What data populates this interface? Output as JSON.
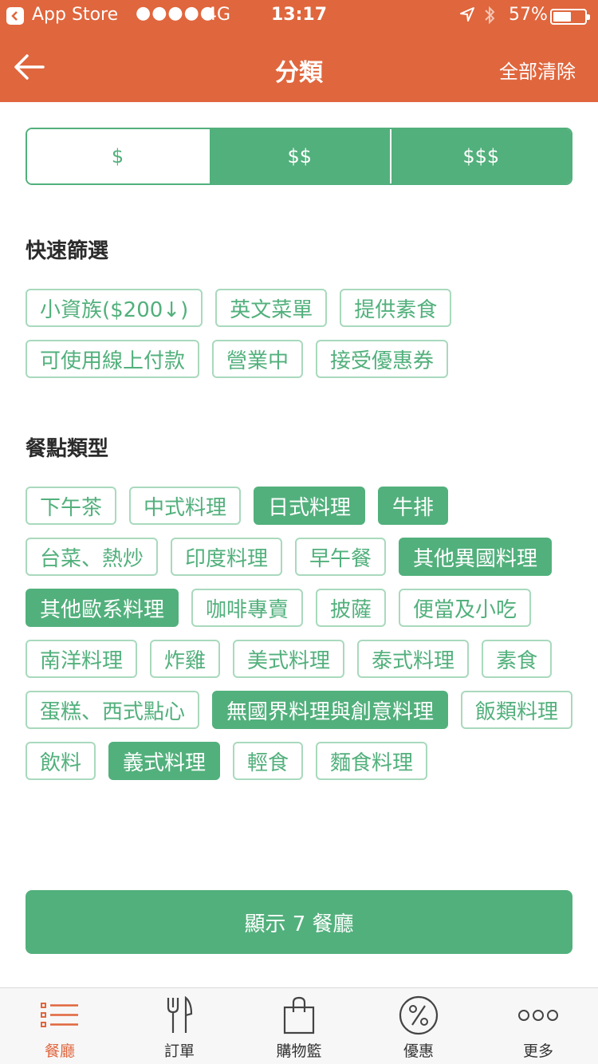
{
  "status_bar": {
    "carrier": "App Store",
    "signal": "●●●●●",
    "network": "4G",
    "time": "13:17",
    "battery": "57%",
    "battery_level": 0.57
  },
  "nav": {
    "title": "分類",
    "clear_all": "全部清除"
  },
  "price_levels": [
    {
      "label": "$",
      "selected": false
    },
    {
      "label": "$$",
      "selected": true
    },
    {
      "label": "$$$",
      "selected": true
    }
  ],
  "quick_filter": {
    "title": "快速篩選",
    "items": [
      {
        "label": "小資族($200↓)",
        "selected": false
      },
      {
        "label": "英文菜單",
        "selected": false
      },
      {
        "label": "提供素食",
        "selected": false
      },
      {
        "label": "可使用線上付款",
        "selected": false
      },
      {
        "label": "營業中",
        "selected": false
      },
      {
        "label": "接受優惠券",
        "selected": false
      }
    ]
  },
  "meal_types": {
    "title": "餐點類型",
    "items": [
      {
        "label": "下午茶",
        "selected": false
      },
      {
        "label": "中式料理",
        "selected": false
      },
      {
        "label": "日式料理",
        "selected": true
      },
      {
        "label": "牛排",
        "selected": true
      },
      {
        "label": "台菜、熱炒",
        "selected": false
      },
      {
        "label": "印度料理",
        "selected": false
      },
      {
        "label": "早午餐",
        "selected": false
      },
      {
        "label": "其他異國料理",
        "selected": true
      },
      {
        "label": "其他歐系料理",
        "selected": true
      },
      {
        "label": "咖啡專賣",
        "selected": false
      },
      {
        "label": "披薩",
        "selected": false
      },
      {
        "label": "便當及小吃",
        "selected": false
      },
      {
        "label": "南洋料理",
        "selected": false
      },
      {
        "label": "炸雞",
        "selected": false
      },
      {
        "label": "美式料理",
        "selected": false
      },
      {
        "label": "泰式料理",
        "selected": false
      },
      {
        "label": "素食",
        "selected": false
      },
      {
        "label": "蛋糕、西式點心",
        "selected": false
      },
      {
        "label": "無國界料理與創意料理",
        "selected": true
      },
      {
        "label": "飯類料理",
        "selected": false
      },
      {
        "label": "飲料",
        "selected": false
      },
      {
        "label": "義式料理",
        "selected": true
      },
      {
        "label": "輕食",
        "selected": false
      },
      {
        "label": "麵食料理",
        "selected": false
      }
    ]
  },
  "show_button": "顯示 7 餐廳",
  "tabs": [
    {
      "label": "餐廳",
      "icon": "list-icon",
      "active": true
    },
    {
      "label": "訂單",
      "icon": "fork-knife-icon",
      "active": false
    },
    {
      "label": "購物籃",
      "icon": "shopping-bag-icon",
      "active": false
    },
    {
      "label": "優惠",
      "icon": "percent-icon",
      "active": false
    },
    {
      "label": "更多",
      "icon": "more-dots-icon",
      "active": false
    }
  ],
  "colors": {
    "header": "#e0663d",
    "accent_green": "#52b07c",
    "chip_border": "#a9d9bd",
    "active_tab": "#e0663d"
  }
}
